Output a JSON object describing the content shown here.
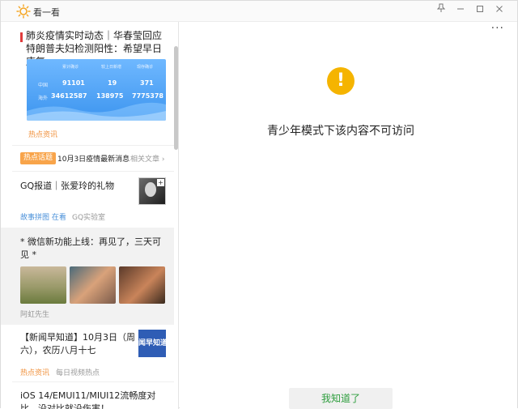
{
  "window": {
    "app_title": "看一看",
    "icons": [
      "sun-logo-icon",
      "pin-icon",
      "minimize-icon",
      "maximize-icon",
      "close-icon"
    ]
  },
  "sidebar": {
    "card1": {
      "title": "肺炎疫情实时动态｜华春莹回应特朗普夫妇检测阳性：希望早日康复",
      "stats": {
        "col_headers": [
          "累计确诊",
          "较上日新增",
          "现存确诊"
        ],
        "rows": [
          {
            "label": "中国",
            "values": [
              "91101",
              "19",
              "371"
            ]
          },
          {
            "label": "海外",
            "values": [
              "34612587",
              "138975",
              "7775378"
            ]
          }
        ]
      },
      "tag": "热点资讯"
    },
    "hot_topic": {
      "badge": "热点话题",
      "headline": "10月3日疫情最新消息",
      "related": "相关文章 ›"
    },
    "gq": {
      "title": "GQ报道｜张爱玲的礼物",
      "source_tag": "故事拼图 在看",
      "source": "GQ实验室"
    },
    "wechat": {
      "title": "* 微信新功能上线：再见了，三天可见 *",
      "author": "阿虹先生"
    },
    "news": {
      "title": "【新闻早知道】10月3日（周六），农历八月十七",
      "thumb_text": "闻早知道",
      "tag": "热点资讯",
      "source": "每日视频热点"
    },
    "ios": {
      "title": "iOS 14/EMUI11/MIUI12流畅度对比，没对比就没伤害！"
    }
  },
  "main": {
    "more": "···",
    "warning_symbol": "!",
    "message": "青少年模式下该内容不可访问",
    "ok_button": "我知道了"
  },
  "colors": {
    "accent_orange": "#f8a44a",
    "warning_yellow": "#f5b400",
    "ok_green": "#2e9e3e",
    "link_blue": "#4a90d9",
    "red_marker": "#e03b3b"
  }
}
